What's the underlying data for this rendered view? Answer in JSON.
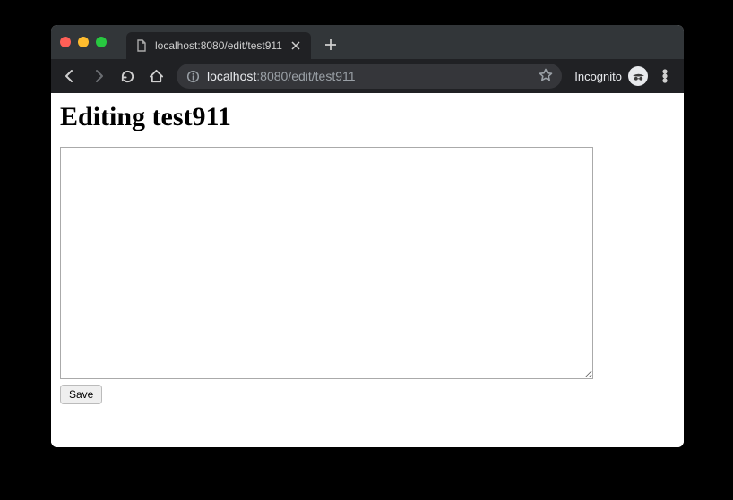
{
  "browser": {
    "tab": {
      "title": "localhost:8080/edit/test911"
    },
    "url": {
      "host_strong": "localhost",
      "host_dim": ":8080",
      "path": "/edit/test911"
    },
    "incognito_label": "Incognito"
  },
  "page": {
    "heading": "Editing test911",
    "textarea_value": "",
    "save_label": "Save"
  }
}
